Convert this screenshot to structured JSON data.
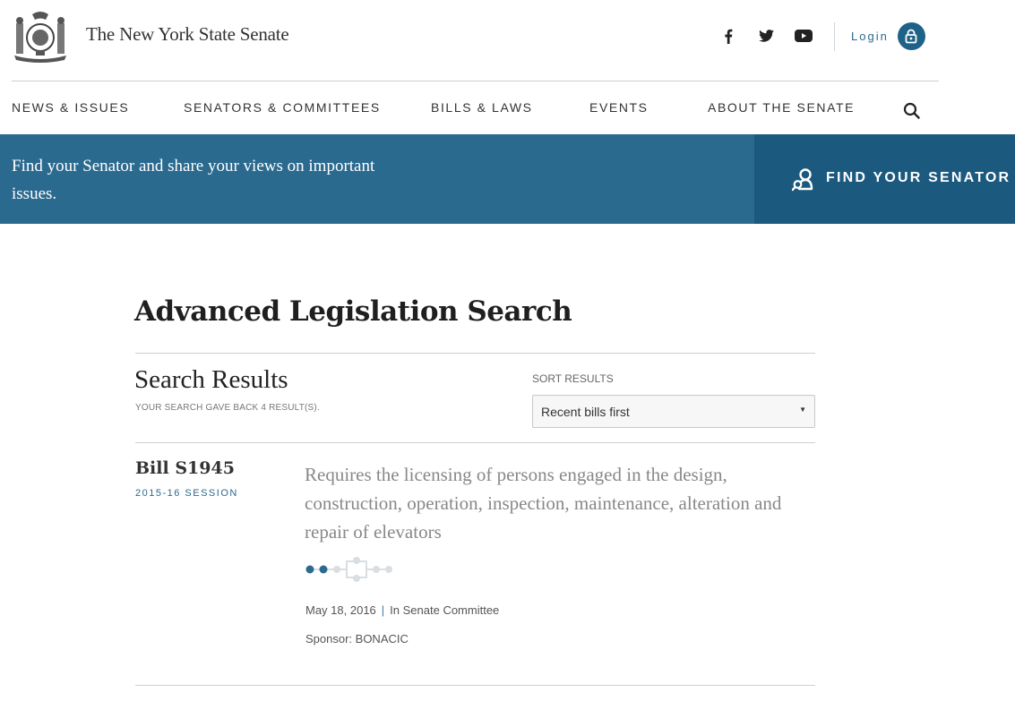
{
  "header": {
    "site_title": "The New York State Senate",
    "social": {
      "facebook_icon": "facebook-icon",
      "twitter_icon": "twitter-icon",
      "youtube_icon": "youtube-icon"
    },
    "login_label": "Login"
  },
  "nav": {
    "items": [
      {
        "label": "NEWS & ISSUES"
      },
      {
        "label": "SENATORS & COMMITTEES"
      },
      {
        "label": "BILLS & LAWS"
      },
      {
        "label": "EVENTS"
      },
      {
        "label": "ABOUT THE SENATE"
      }
    ],
    "search_icon": "search-icon"
  },
  "banner": {
    "text": "Find your Senator and share your views on important issues.",
    "button_label": "FIND YOUR SENATOR"
  },
  "main": {
    "heading": "Advanced Legislation Search",
    "results_title": "Search Results",
    "results_count": "YOUR SEARCH GAVE BACK 4 RESULT(S).",
    "sort_label": "SORT RESULTS",
    "sort_value": "Recent bills first"
  },
  "results": [
    {
      "bill_id": "Bill S1945",
      "session": "2015-16 SESSION",
      "description": "Requires the licensing of persons engaged in the design, construction, operation, inspection, maintenance, alteration and repair of elevators",
      "date": "May 18, 2016",
      "meta_separator": "|",
      "status": "In Senate Committee",
      "sponsor": "Sponsor: BONACIC",
      "progress_completed_steps": 2
    }
  ],
  "colors": {
    "brand_blue": "#2b6a8f",
    "brand_blue_dark": "#1b5a7e",
    "progress_active": "#2b6a8f",
    "progress_inactive": "#d9dee2"
  }
}
